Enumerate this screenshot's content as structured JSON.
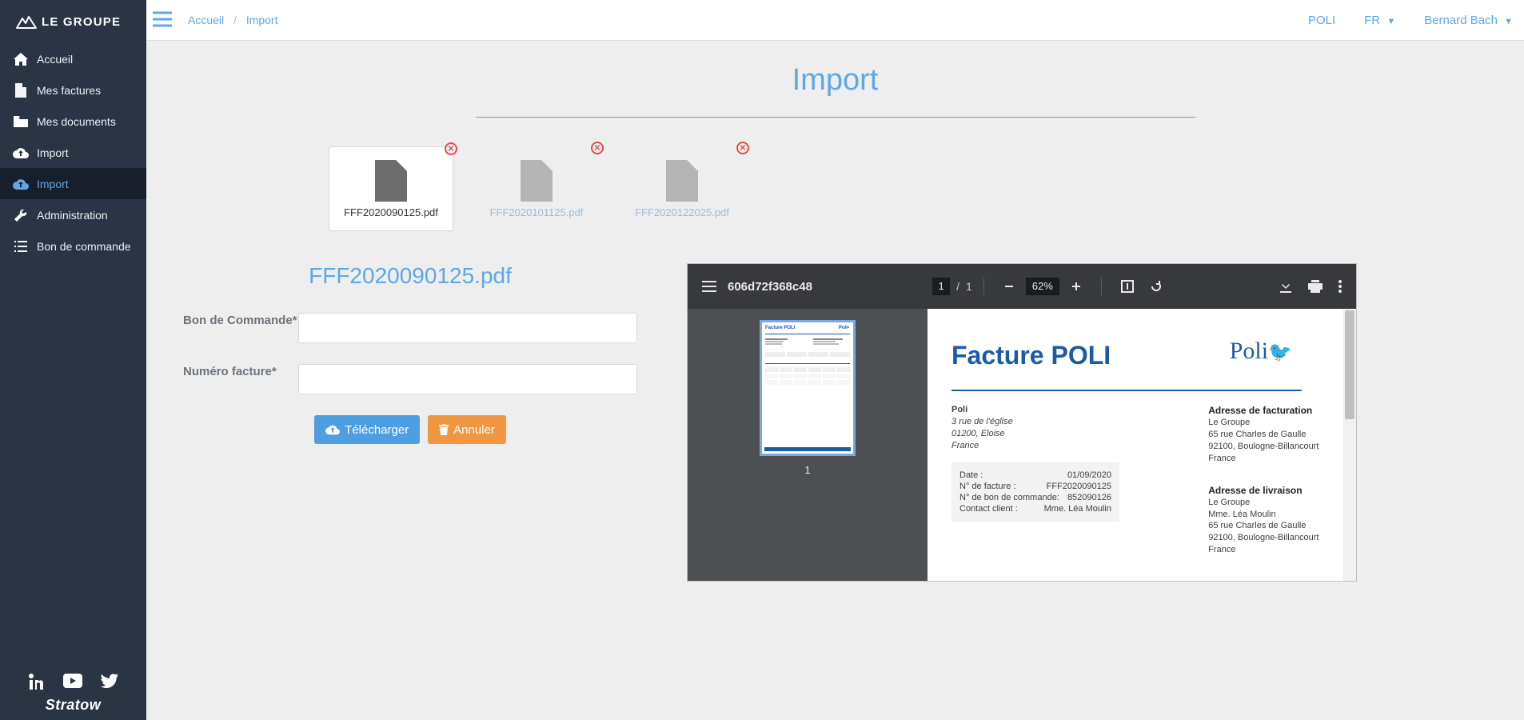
{
  "logo_text": "LE GROUPE",
  "sidebar": {
    "items": [
      {
        "label": "Accueil"
      },
      {
        "label": "Mes factures"
      },
      {
        "label": "Mes documents"
      },
      {
        "label": "Import"
      },
      {
        "label": "Import"
      },
      {
        "label": "Administration"
      },
      {
        "label": "Bon de commande"
      }
    ]
  },
  "footer_brand": "Stratow",
  "breadcrumb": {
    "home": "Accueil",
    "current": "Import"
  },
  "topbar": {
    "org": "POLI",
    "lang": "FR",
    "user": "Bernard Bach"
  },
  "page_title": "Import",
  "files": [
    {
      "name": "FFF2020090125.pdf"
    },
    {
      "name": "FFF2020101125.pdf"
    },
    {
      "name": "FFF2020122025.pdf"
    }
  ],
  "form": {
    "title": "FFF2020090125.pdf",
    "bon_label": "Bon de Commande*",
    "num_label": "Numéro facture*",
    "upload_btn": "Télécharger",
    "cancel_btn": "Annuler"
  },
  "viewer": {
    "title": "606d72f368c48",
    "page": "1",
    "total": "1",
    "zoom": "62%",
    "thumb_num": "1"
  },
  "doc": {
    "title": "Facture POLI",
    "logo": "Poli",
    "seller_name": "Poli",
    "seller_addr1": "3 rue de l'église",
    "seller_addr2": "01200, Eloise",
    "seller_addr3": "France",
    "bill_heading": "Adresse de facturation",
    "bill_l1": "Le Groupe",
    "bill_l2": "65 rue Charles de Gaulle",
    "bill_l3": "92100, Boulogne-Billancourt",
    "bill_l4": "France",
    "ship_heading": "Adresse de livraison",
    "ship_l1": "Le Groupe",
    "ship_l2": "Mme. Léa Moulin",
    "ship_l3": "65 rue Charles de Gaulle",
    "ship_l4": "92100, Boulogne-Billancourt",
    "ship_l5": "France",
    "date_k": "Date :",
    "date_v": "01/09/2020",
    "fact_k": "N° de facture :",
    "fact_v": "FFF2020090125",
    "bon_k": "N° de bon de commande:",
    "bon_v": "852090126",
    "contact_k": "Contact client :",
    "contact_v": "Mme. Léa Moulin"
  }
}
